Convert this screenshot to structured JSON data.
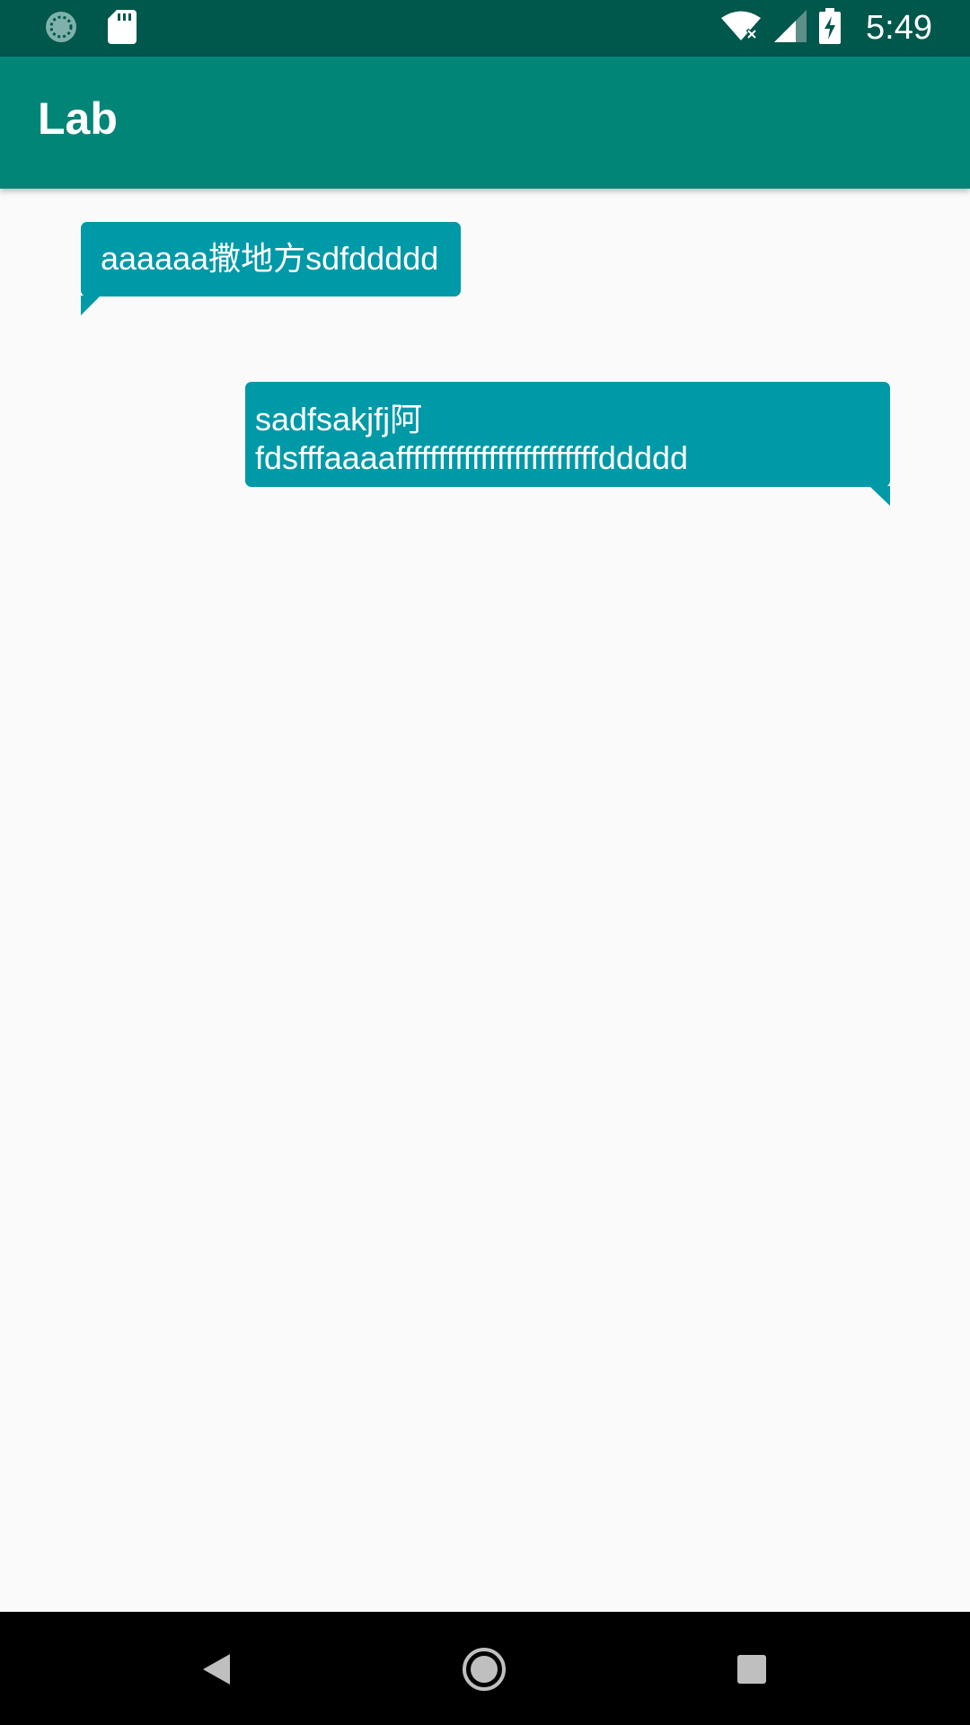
{
  "status_bar": {
    "time": "5:49",
    "left_icons": [
      "loading-icon",
      "sd-card-icon"
    ],
    "right_icons": [
      "wifi-no-internet-icon",
      "cellular-signal-icon",
      "battery-charging-icon"
    ]
  },
  "app_bar": {
    "title": "Lab"
  },
  "messages": [
    {
      "side": "left",
      "text": "aaaaaa撒地方sdfddddd"
    },
    {
      "side": "right",
      "text": "sadfsakjfj阿\nfdsfffaaaaffffffffffffffffffffffffddddd"
    }
  ],
  "nav_bar": {
    "icons": [
      "back-icon",
      "home-icon",
      "recent-apps-icon"
    ]
  },
  "colors": {
    "status_bar": "#00574b",
    "app_bar": "#008577",
    "bubble": "#0099a8",
    "background": "#fafafa"
  }
}
